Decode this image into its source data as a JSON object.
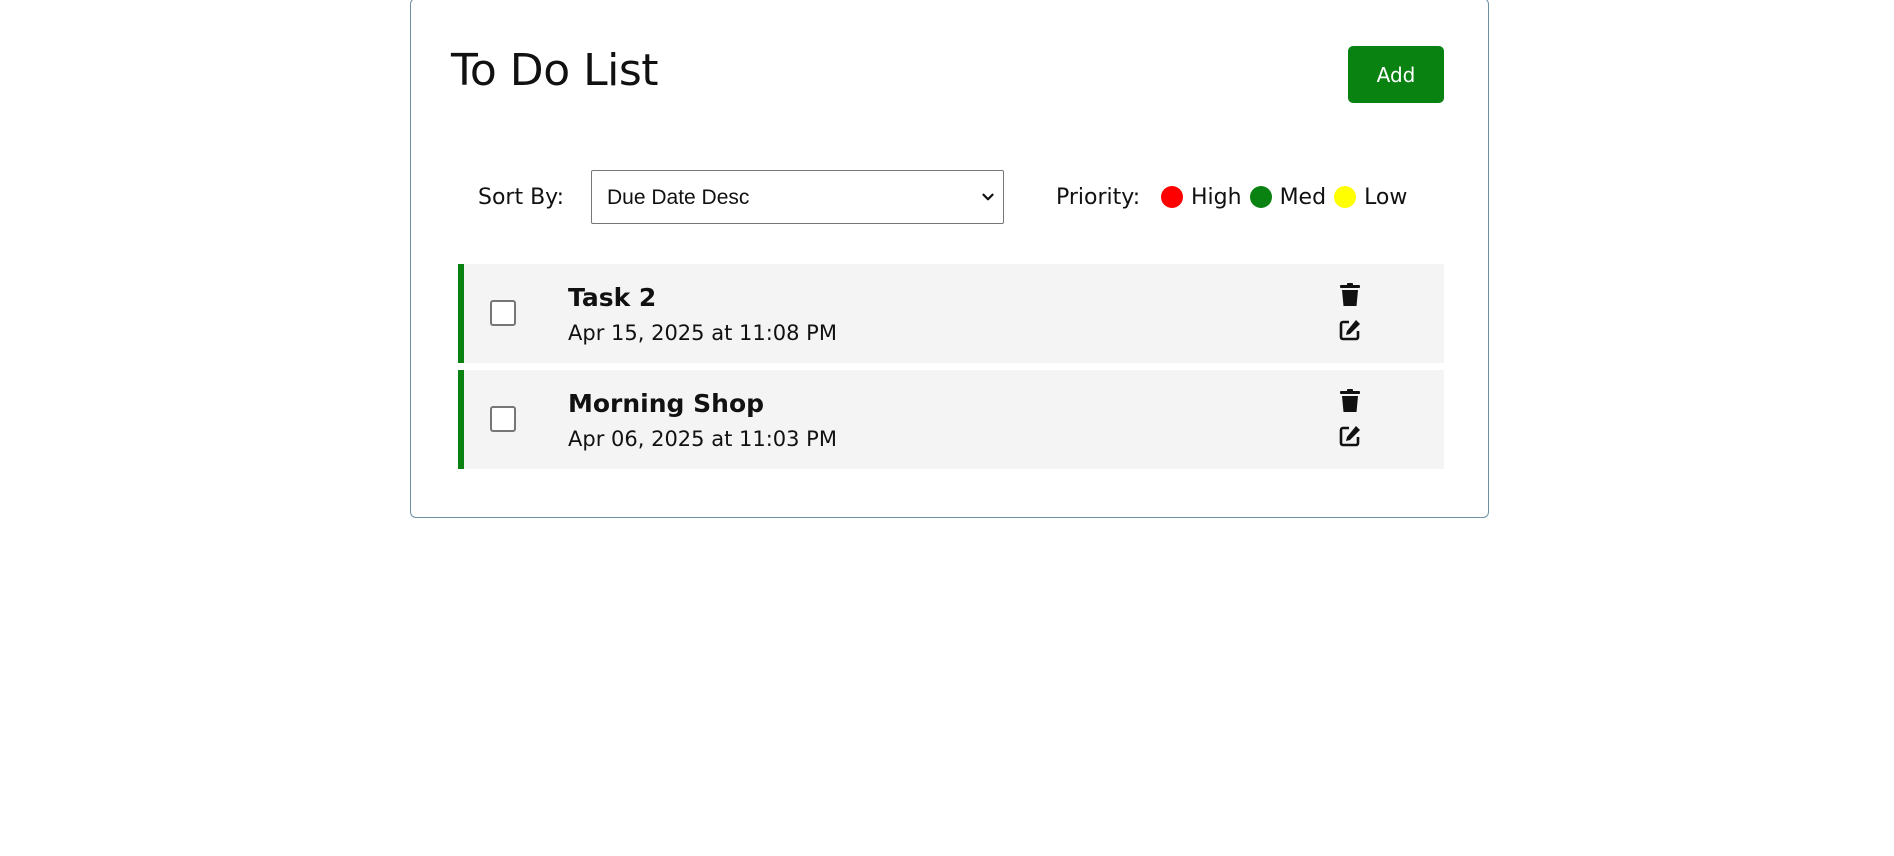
{
  "app": {
    "title": "To Do List",
    "add_label": "Add"
  },
  "sort": {
    "label": "Sort By:",
    "selected": "Due Date Desc"
  },
  "priority": {
    "label": "Priority:",
    "levels": [
      {
        "name": "High",
        "color": "#ff0000"
      },
      {
        "name": "Med",
        "color": "#0a8212"
      },
      {
        "name": "Low",
        "color": "#ffff00"
      }
    ]
  },
  "tasks": [
    {
      "title": "Task 2",
      "date": "Apr 15, 2025 at 11:08 PM",
      "priority_color": "#0a8212",
      "completed": false
    },
    {
      "title": "Morning Shop",
      "date": "Apr 06, 2025 at 11:03 PM",
      "priority_color": "#0a8212",
      "completed": false
    }
  ],
  "icons": {
    "delete": "trash-icon",
    "edit": "edit-icon",
    "dropdown": "chevron-down-icon"
  }
}
